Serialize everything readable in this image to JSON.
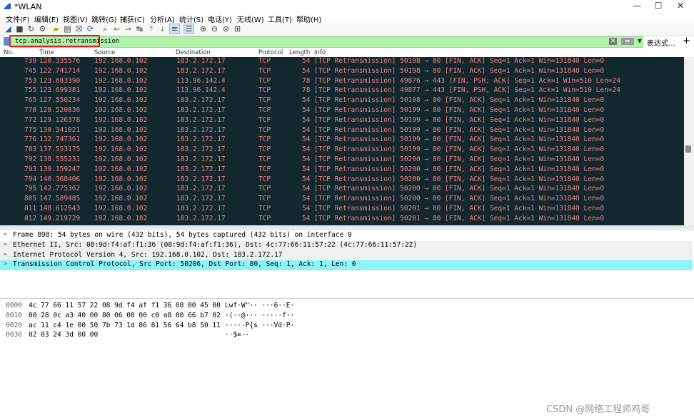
{
  "window": {
    "title": "*WLAN",
    "controls": [
      "—",
      "☐",
      "✕"
    ]
  },
  "menu": [
    "文件(F)",
    "编辑(E)",
    "视图(V)",
    "跳转(G)",
    "捕获(C)",
    "分析(A)",
    "统计(S)",
    "电话(Y)",
    "无线(W)",
    "工具(T)",
    "帮助(H)"
  ],
  "toolbar_icons": [
    "shark-fin-start-icon",
    "stop-square-icon",
    "restart-icon",
    "capture-options-gear-icon",
    "open-folder-icon",
    "save-file-icon",
    "close-file-icon",
    "reload-icon",
    "find-magnifier-icon",
    "go-back-icon",
    "go-forward-icon",
    "go-to-packet-icon",
    "go-first-icon",
    "go-last-icon",
    "autoscroll-icon",
    "colorize-icon",
    "zoom-in-icon",
    "zoom-out-icon",
    "zoom-normal-icon",
    "resize-columns-icon"
  ],
  "filter": {
    "value": "tcp.analysis.retransmission",
    "expression_label": "表达式…",
    "plus_label": "+",
    "bg": "#aff2a8"
  },
  "columns": [
    "No.",
    "Time",
    "Source",
    "Destination",
    "Protocol",
    "Length",
    "Info"
  ],
  "packets": [
    [
      "739",
      "120.335576",
      "192.168.0.102",
      "183.2.172.17",
      "TCP",
      "54",
      "[TCP Retransmission] 50198 → 80 [FIN, ACK] Seq=1 Ack=1 Win=131840 Len=0"
    ],
    [
      "745",
      "122.741714",
      "192.168.0.102",
      "183.2.172.17",
      "TCP",
      "54",
      "[TCP Retransmission] 50198 → 80 [FIN, ACK] Seq=1 Ack=1 Win=131840 Len=0"
    ],
    [
      "753",
      "123.683390",
      "192.168.0.102",
      "113.96.142.4",
      "TCP",
      "78",
      "[TCP Retransmission] 49876 → 443 [FIN, PSH, ACK] Seq=1 Ack=1 Win=510 Len=24"
    ],
    [
      "755",
      "123.699381",
      "192.168.0.102",
      "113.96.142.4",
      "TCP",
      "78",
      "[TCP Retransmission] 49877 → 443 [FIN, PSH, ACK] Seq=1 Ack=1 Win=510 Len=24"
    ],
    [
      "765",
      "127.550234",
      "192.168.0.102",
      "183.2.172.17",
      "TCP",
      "54",
      "[TCP Retransmission] 50198 → 80 [FIN, ACK] Seq=1 Ack=1 Win=131840 Len=0"
    ],
    [
      "770",
      "128.520836",
      "192.168.0.102",
      "183.2.172.17",
      "TCP",
      "54",
      "[TCP Retransmission] 50199 → 80 [FIN, ACK] Seq=1 Ack=1 Win=131840 Len=0"
    ],
    [
      "772",
      "129.126378",
      "192.168.0.102",
      "183.2.172.17",
      "TCP",
      "54",
      "[TCP Retransmission] 50199 → 80 [FIN, ACK] Seq=1 Ack=1 Win=131840 Len=0"
    ],
    [
      "775",
      "130.341021",
      "192.168.0.102",
      "183.2.172.17",
      "TCP",
      "54",
      "[TCP Retransmission] 50199 → 80 [FIN, ACK] Seq=1 Ack=1 Win=131840 Len=0"
    ],
    [
      "776",
      "132.747361",
      "192.168.0.102",
      "183.2.172.17",
      "TCP",
      "54",
      "[TCP Retransmission] 50199 → 80 [FIN, ACK] Seq=1 Ack=1 Win=131840 Len=0"
    ],
    [
      "783",
      "137.553175",
      "192.168.0.102",
      "183.2.172.17",
      "TCP",
      "54",
      "[TCP Retransmission] 50199 → 80 [FIN, ACK] Seq=1 Ack=1 Win=131840 Len=0"
    ],
    [
      "792",
      "138.555231",
      "192.168.0.102",
      "183.2.172.17",
      "TCP",
      "54",
      "[TCP Retransmission] 50200 → 80 [FIN, ACK] Seq=1 Ack=1 Win=131840 Len=0"
    ],
    [
      "793",
      "139.159247",
      "192.168.0.102",
      "183.2.172.17",
      "TCP",
      "54",
      "[TCP Retransmission] 50200 → 80 [FIN, ACK] Seq=1 Ack=1 Win=131840 Len=0"
    ],
    [
      "794",
      "140.368406",
      "192.168.0.102",
      "183.2.172.17",
      "TCP",
      "54",
      "[TCP Retransmission] 50200 → 80 [FIN, ACK] Seq=1 Ack=1 Win=131840 Len=0"
    ],
    [
      "795",
      "142.775362",
      "192.168.0.102",
      "183.2.172.17",
      "TCP",
      "54",
      "[TCP Retransmission] 50200 → 80 [FIN, ACK] Seq=1 Ack=1 Win=131840 Len=0"
    ],
    [
      "805",
      "147.589485",
      "192.168.0.102",
      "183.2.172.17",
      "TCP",
      "54",
      "[TCP Retransmission] 50200 → 80 [FIN, ACK] Seq=1 Ack=1 Win=131840 Len=0"
    ],
    [
      "811",
      "148.612543",
      "192.168.0.102",
      "183.2.172.17",
      "TCP",
      "54",
      "[TCP Retransmission] 50201 → 80 [FIN, ACK] Seq=1 Ack=1 Win=131840 Len=0"
    ],
    [
      "812",
      "149.219729",
      "192.168.0.102",
      "183.2.172.17",
      "TCP",
      "54",
      "[TCP Retransmission] 50201 → 80 [FIN, ACK] Seq=1 Ack=1 Win=131840 Len=0"
    ]
  ],
  "details": [
    {
      "text": "Frame 898: 54 bytes on wire (432 bits), 54 bytes captured (432 bits) on interface 0",
      "bg": "#ffffff"
    },
    {
      "text": "Ethernet II, Src: 08:9d:f4:af:f1:36 (08:9d:f4:af:f1:36), Dst: 4c:77:66:11:57:22 (4c:77:66:11:57:22)",
      "bg": "#f0f0f0"
    },
    {
      "text": "Internet Protocol Version 4, Src: 192.168.0.102, Dst: 183.2.172.17",
      "bg": "#f0f0f0"
    },
    {
      "text": "Transmission Control Protocol, Src Port: 50206, Dst Port: 80, Seq: 1, Ack: 1, Len: 0",
      "bg": "#8cf5fb"
    }
  ],
  "bytes": [
    {
      "offset": "0000",
      "hex": "4c 77 66 11 57 22 08 9d  f4 af f1 36 08 00 45 00",
      "ascii": "Lwf·W\"··  ···6··E·"
    },
    {
      "offset": "0010",
      "hex": "00 28 0c a3 40 00 80 06  00 00 c0 a8 00 66 b7 02",
      "ascii": "·(··@···  ·····f··"
    },
    {
      "offset": "0020",
      "hex": "ac 11 c4 1e 00 50 7b 73  1d 86 81 56 64 b8 50 11",
      "ascii": "·····P{s  ···Vd·P·"
    },
    {
      "offset": "0030",
      "hex": "02 03 24 3d 00 00",
      "ascii": "··$=··"
    }
  ],
  "watermark": "CSDN @网络工程师鸡哥",
  "colors": {
    "list_bg": "#12272e",
    "list_fg": "#f1847b",
    "selected_detail": "#8cf5fb",
    "filter_highlight": "#e02020"
  }
}
